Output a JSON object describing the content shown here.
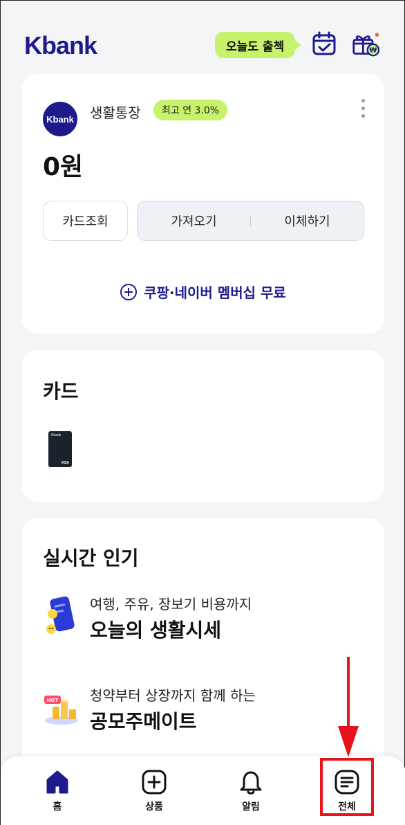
{
  "header": {
    "logo": "Kbank",
    "checkin_label": "오늘도 출첵",
    "icons": [
      "calendar-check-icon",
      "gift-won-icon"
    ]
  },
  "account": {
    "logo_text": "Kbank",
    "name": "생활통장",
    "rate_badge": "최고 연 3.0%",
    "balance": "0원",
    "card_lookup": "카드조회",
    "bring": "가져오기",
    "transfer": "이체하기",
    "promo": "쿠팡·네이버 멤버십 무료"
  },
  "cards": {
    "title": "카드",
    "thumb_brand": "Kbank",
    "thumb_network": "VISA"
  },
  "popular": {
    "title": "실시간 인기",
    "items": [
      {
        "subtitle": "여행, 주유, 장보기 비용까지",
        "title": "오늘의 생활시세",
        "icon": "phone-emoji-icon"
      },
      {
        "subtitle": "청약부터 상장까지 함께 하는",
        "title": "공모주메이트",
        "icon": "hot-coins-icon"
      }
    ]
  },
  "nav": {
    "items": [
      {
        "label": "홈",
        "icon": "home-icon",
        "active": true
      },
      {
        "label": "상품",
        "icon": "plus-square-icon",
        "active": false
      },
      {
        "label": "알림",
        "icon": "bell-icon",
        "active": false
      },
      {
        "label": "전체",
        "icon": "menu-list-icon",
        "active": false
      }
    ]
  },
  "colors": {
    "brand": "#1e1a8c",
    "accent": "#c6f36b",
    "highlight": "#e8141b"
  }
}
